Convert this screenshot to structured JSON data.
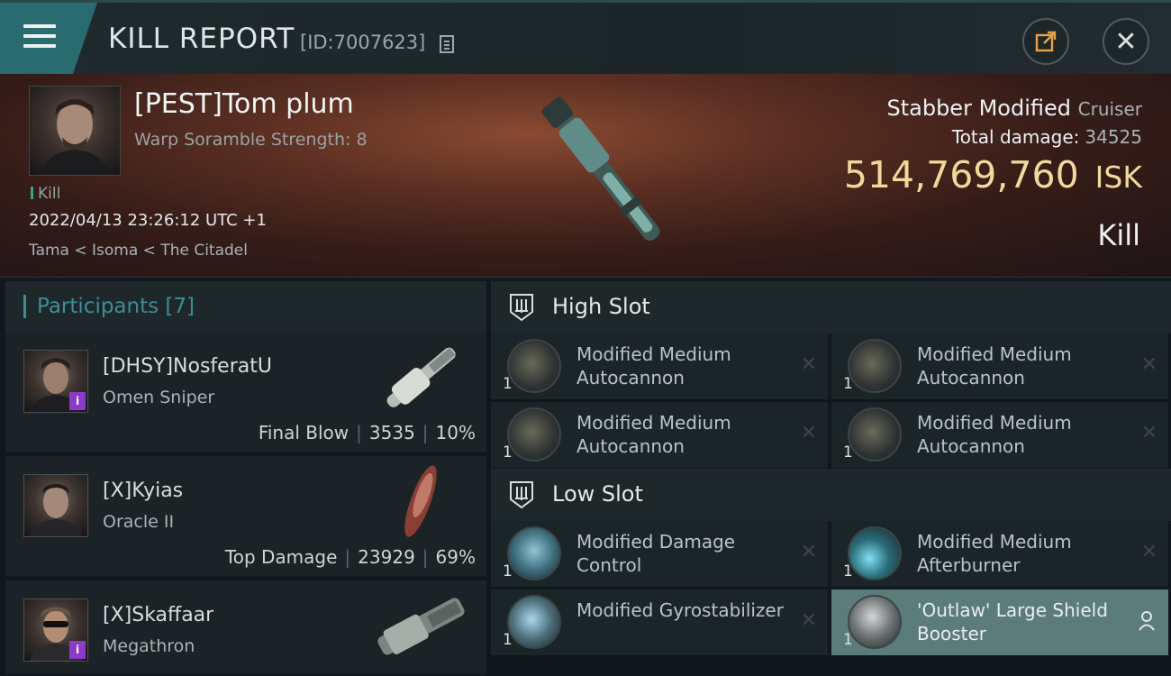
{
  "header": {
    "title": "KILL REPORT",
    "report_id": "[ID:7007623]"
  },
  "victim": {
    "name": "[PEST]Tom plum",
    "scramble": "Warp Soramble Strength: 8",
    "kill_tag": "Kill",
    "datetime": "2022/04/13 23:26:12 UTC +1",
    "location": "Tama < Isoma < The Citadel",
    "ship_name": "Stabber Modified",
    "ship_class": "Cruiser",
    "total_damage_label": "Total damage:",
    "total_damage": "34525",
    "isk_value": "514,769,760",
    "isk_unit": "ISK",
    "result": "Kill"
  },
  "participants": {
    "label": "Participants [7]",
    "rows": [
      {
        "name": "[DHSY]NosferatU",
        "ship": "Omen Sniper",
        "role": "Final Blow",
        "damage": "3535",
        "percent": "10%",
        "badge": "i"
      },
      {
        "name": "[X]Kyias",
        "ship": "Oracle II",
        "role": "Top Damage",
        "damage": "23929",
        "percent": "69%",
        "badge": ""
      },
      {
        "name": "[X]Skaffaar",
        "ship": "Megathron",
        "role": "",
        "damage": "",
        "percent": "",
        "badge": "i"
      }
    ]
  },
  "fittings": {
    "high_slot_label": "High Slot",
    "low_slot_label": "Low Slot",
    "high": [
      {
        "name": "Modified Medium Autocannon",
        "qty": "1"
      },
      {
        "name": "Modified Medium Autocannon",
        "qty": "1"
      },
      {
        "name": "Modified Medium Autocannon",
        "qty": "1"
      },
      {
        "name": "Modified Medium Autocannon",
        "qty": "1"
      }
    ],
    "low": [
      {
        "name": "Modified Damage Control",
        "qty": "1"
      },
      {
        "name": "Modified Medium Afterburner",
        "qty": "1"
      },
      {
        "name": "Modified Gyrostabilizer",
        "qty": "1"
      },
      {
        "name": "'Outlaw' Large Shield Booster",
        "qty": "1"
      }
    ]
  },
  "colors": {
    "accent": "#2a6b6f",
    "isk": "#f2d89a",
    "badge": "#8a3cc8"
  }
}
